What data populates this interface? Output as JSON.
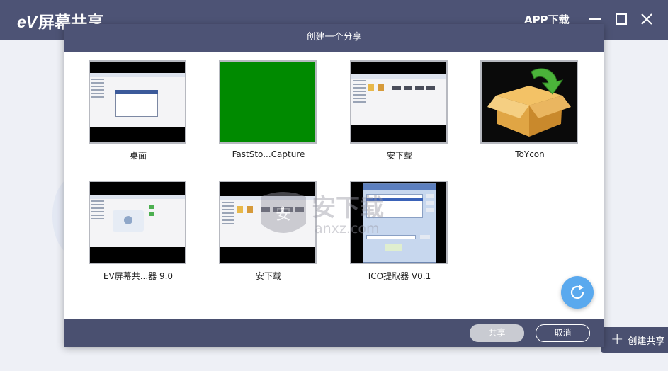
{
  "app": {
    "logo_prefix": "eV",
    "logo_text": "屏幕共享",
    "app_download": "APP下载"
  },
  "dialog": {
    "title": "创建一个分享",
    "tiles": [
      {
        "label": "桌面"
      },
      {
        "label": "FastSto...Capture"
      },
      {
        "label": "安下载"
      },
      {
        "label": "ToYcon"
      },
      {
        "label": "EV屏幕共...器 9.0"
      },
      {
        "label": "安下载"
      },
      {
        "label": "ICO提取器 V0.1"
      }
    ],
    "share_button": "共享",
    "cancel_button": "取消"
  },
  "sidebar_action": {
    "create_share": "创建共享"
  },
  "watermark": {
    "text": "安下载",
    "subtext": "anxz.com"
  },
  "colors": {
    "title_bar": "#4d5375",
    "accent_blue": "#5aa9ee",
    "green_capture": "#008a00"
  }
}
